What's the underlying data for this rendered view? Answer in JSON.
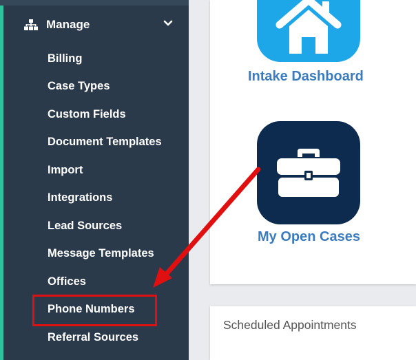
{
  "sidebar": {
    "manage_label": "Manage",
    "items": [
      {
        "label": "Billing"
      },
      {
        "label": "Case Types"
      },
      {
        "label": "Custom Fields"
      },
      {
        "label": "Document Templates"
      },
      {
        "label": "Import"
      },
      {
        "label": "Integrations"
      },
      {
        "label": "Lead Sources"
      },
      {
        "label": "Message Templates"
      },
      {
        "label": "Offices"
      },
      {
        "label": "Phone Numbers"
      },
      {
        "label": "Referral Sources"
      }
    ]
  },
  "dashboard": {
    "tiles": [
      {
        "label": "Intake Dashboard",
        "icon": "home-icon",
        "color": "#1ea7e8"
      },
      {
        "label": "My Open Cases",
        "icon": "briefcase-icon",
        "color": "#0d2a4f"
      }
    ],
    "scheduled_title": "Scheduled Appointments"
  },
  "annotation": {
    "highlighted_item": "Phone Numbers",
    "highlight_color": "#e01010"
  },
  "colors": {
    "sidebar_bg": "#2b3a4a",
    "accent": "#2ec4a0",
    "tile_label": "#3a7cbf"
  }
}
